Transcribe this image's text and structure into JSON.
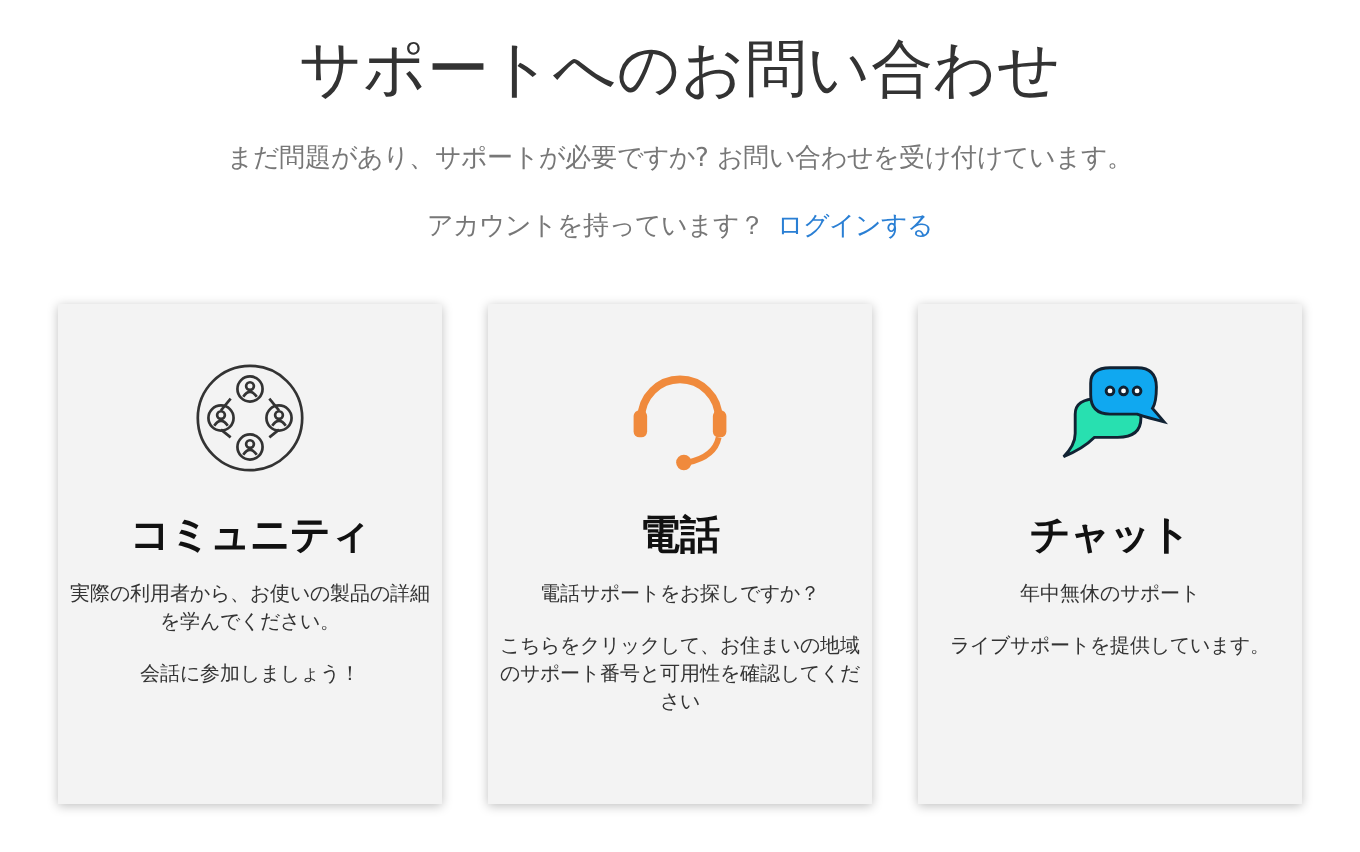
{
  "title": "サポートへのお問い合わせ",
  "subtitle": "まだ問題があり、サポートが必要ですか? お問い合わせを受け付けています。",
  "account": {
    "prompt": "アカウントを持っています？",
    "link": "ログインする"
  },
  "cards": [
    {
      "kind": "community",
      "title": "コミュニティ",
      "paragraphs": [
        "実際の利用者から、お使いの製品の詳細を学んでください。",
        "会話に参加しましょう！"
      ]
    },
    {
      "kind": "phone",
      "title": "電話",
      "paragraphs": [
        "電話サポートをお探しですか？",
        "こちらをクリックして、お住まいの地域のサポート番号と可用性を確認してください"
      ]
    },
    {
      "kind": "chat",
      "title": "チャット",
      "paragraphs": [
        "年中無休のサポート",
        "ライブサポートを提供しています。"
      ]
    }
  ]
}
